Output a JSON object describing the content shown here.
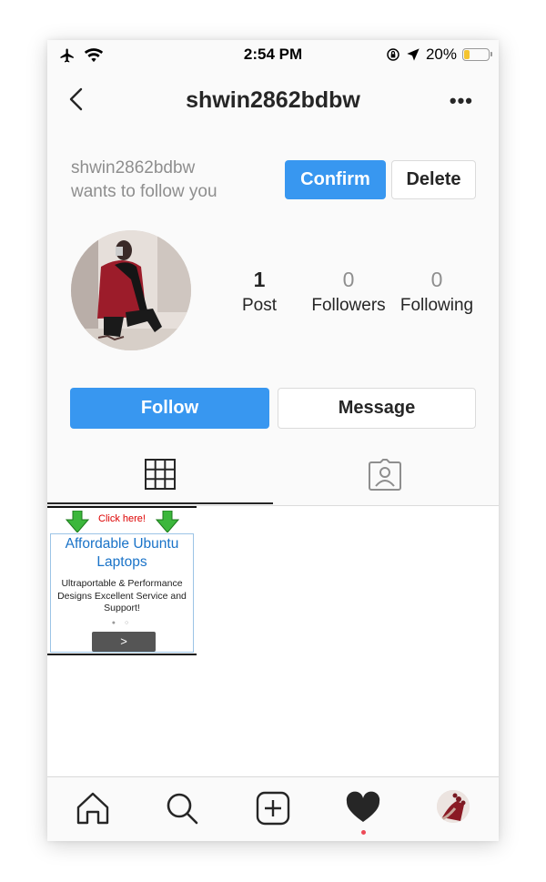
{
  "status_bar": {
    "time": "2:54 PM",
    "battery_percent": "20%",
    "battery_level": 0.2,
    "icons": [
      "airplane-icon",
      "wifi-icon",
      "orientation-lock-icon",
      "location-arrow-icon",
      "battery-icon"
    ]
  },
  "header": {
    "title": "shwin2862bdbw",
    "back_icon": "chevron-left-icon",
    "more_icon": "more-options-icon",
    "more_label": "•••"
  },
  "follow_request": {
    "line1": "shwin2862bdbw",
    "line2": "wants to follow you",
    "confirm_label": "Confirm",
    "delete_label": "Delete"
  },
  "profile": {
    "stats": [
      {
        "value": "1",
        "label": "Post"
      },
      {
        "value": "0",
        "label": "Followers"
      },
      {
        "value": "0",
        "label": "Following"
      }
    ],
    "follow_label": "Follow",
    "message_label": "Message"
  },
  "tabs": [
    {
      "icon": "grid-icon",
      "active": true
    },
    {
      "icon": "tagged-icon",
      "active": false
    }
  ],
  "posts": [
    {
      "click_text": "Click here!",
      "title": "Affordable Ubuntu Laptops",
      "text": "Ultraportable & Performance Designs Excellent Service and Support!",
      "button_glyph": ">"
    }
  ],
  "bottom_nav": [
    "home-icon",
    "search-icon",
    "add-post-icon",
    "activity-heart-icon",
    "profile-avatar"
  ],
  "colors": {
    "accent": "#3897f0",
    "text": "#262626",
    "muted": "#8e8e8e",
    "notification": "#ed4956"
  }
}
